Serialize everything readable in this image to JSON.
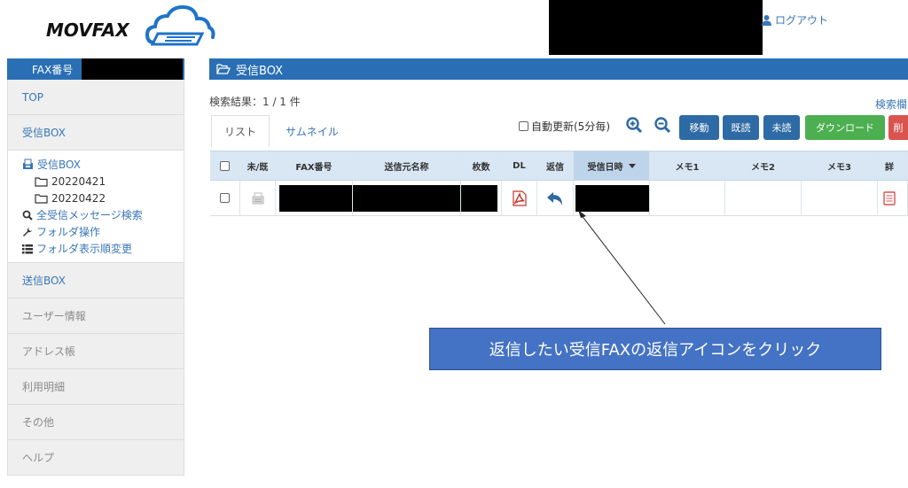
{
  "header": {
    "logo_text": "MOVFAX",
    "logout_label": "ログアウト"
  },
  "sidebar": {
    "title": "FAX番号",
    "items": [
      {
        "label": "TOP"
      },
      {
        "label": "受信BOX"
      }
    ],
    "inbox_sub": {
      "root": "受信BOX",
      "folders": [
        "20220421",
        "20220422"
      ],
      "search_all": "全受信メッセージ検索",
      "folder_ops": "フォルダ操作",
      "folder_order": "フォルダ表示順変更"
    },
    "items_after": [
      {
        "label": "送信BOX",
        "style": "blue"
      },
      {
        "label": "ユーザー情報",
        "style": "gray"
      },
      {
        "label": "アドレス帳",
        "style": "gray"
      },
      {
        "label": "利用明細",
        "style": "gray"
      },
      {
        "label": "その他",
        "style": "gray"
      },
      {
        "label": "ヘルプ",
        "style": "gray"
      }
    ]
  },
  "main": {
    "title": "受信BOX",
    "result_text": "検索結果：1 / 1 件",
    "search_link": "検索欄",
    "tabs": [
      "リスト",
      "サムネイル"
    ],
    "auto_refresh_label": "自動更新(5分毎)",
    "buttons": {
      "move": "移動",
      "read": "既読",
      "unread": "未読",
      "download": "ダウンロード",
      "delete": "削"
    },
    "columns": [
      "未/既",
      "FAX番号",
      "送信元名称",
      "枚数",
      "DL",
      "返信",
      "受信日時",
      "メモ1",
      "メモ2",
      "メモ3",
      "詳"
    ]
  },
  "callout_text": "返信したい受信FAXの返信アイコンをクリック",
  "colors": {
    "accent": "#2a6fb5",
    "btn_blue": "#2e6aa5",
    "btn_green": "#4caf50",
    "btn_red": "#d9534f",
    "callout": "#4472c4"
  }
}
